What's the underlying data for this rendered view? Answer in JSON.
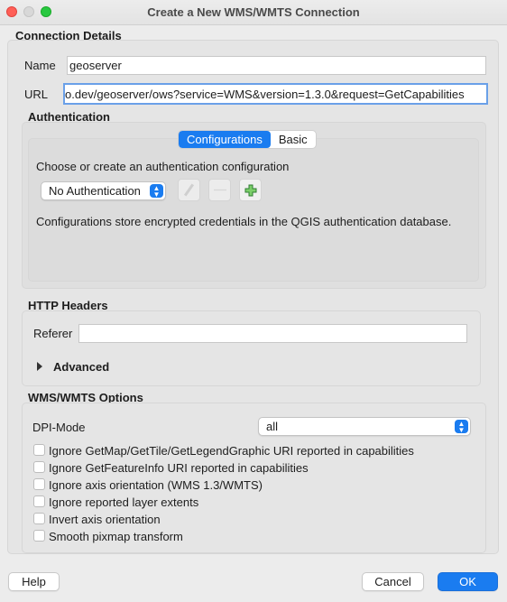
{
  "window": {
    "title": "Create a New WMS/WMTS Connection"
  },
  "connection": {
    "heading": "Connection Details",
    "name_label": "Name",
    "name_value": "geoserver",
    "url_label": "URL",
    "url_value": "o.dev/geoserver/ows?service=WMS&version=1.3.0&request=GetCapabilities"
  },
  "auth": {
    "heading": "Authentication",
    "tabs": [
      "Configurations",
      "Basic"
    ],
    "choose_label": "Choose or create an authentication configuration",
    "selected": "No Authentication",
    "info": "Configurations store encrypted credentials in the QGIS authentication database."
  },
  "http": {
    "heading": "HTTP Headers",
    "referer_label": "Referer",
    "referer_value": "",
    "advanced_label": "Advanced"
  },
  "options": {
    "heading": "WMS/WMTS Options",
    "dpi_label": "DPI-Mode",
    "dpi_value": "all",
    "checks": [
      "Ignore GetMap/GetTile/GetLegendGraphic URI reported in capabilities",
      "Ignore GetFeatureInfo URI reported in capabilities",
      "Ignore axis orientation (WMS 1.3/WMTS)",
      "Ignore reported layer extents",
      "Invert axis orientation",
      "Smooth pixmap transform"
    ]
  },
  "footer": {
    "help": "Help",
    "cancel": "Cancel",
    "ok": "OK"
  }
}
